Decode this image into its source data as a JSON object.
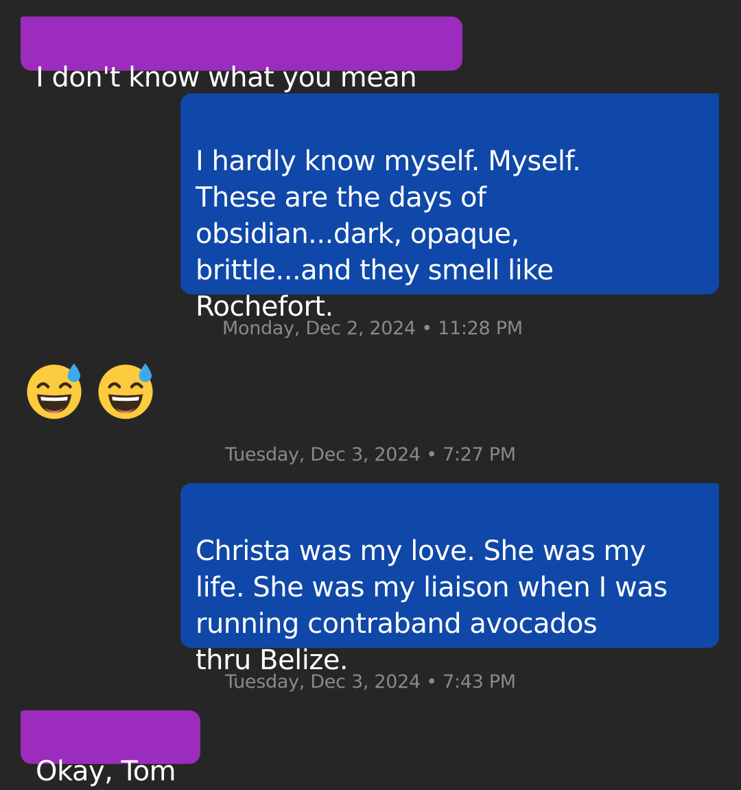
{
  "conversation": {
    "messages": [
      {
        "sender": "them",
        "text": "I don't know what you mean"
      },
      {
        "sender": "me",
        "text": "I hardly know myself.  Myself.\nThese are the days of\nobsidian...dark, opaque,\nbrittle...and they smell like\nRochefort."
      },
      {
        "sender": "them",
        "emoji": [
          "grinning-face-with-sweat",
          "grinning-face-with-sweat"
        ]
      },
      {
        "sender": "me",
        "text": "Christa was my love.  She was my\nlife.  She was my liaison when I was\nrunning contraband avocados\nthru Belize."
      },
      {
        "sender": "them",
        "text": "Okay, Tom"
      }
    ],
    "timestamps": [
      "Monday, Dec 2, 2024 • 11:28 PM",
      "Tuesday, Dec 3, 2024 • 7:27 PM",
      "Tuesday, Dec 3, 2024 • 7:43 PM"
    ]
  },
  "colors": {
    "background": "#262626",
    "incoming_bubble": "#9b2cbd",
    "outgoing_bubble": "#0f48a8",
    "timestamp_text": "#8a8a8a"
  }
}
